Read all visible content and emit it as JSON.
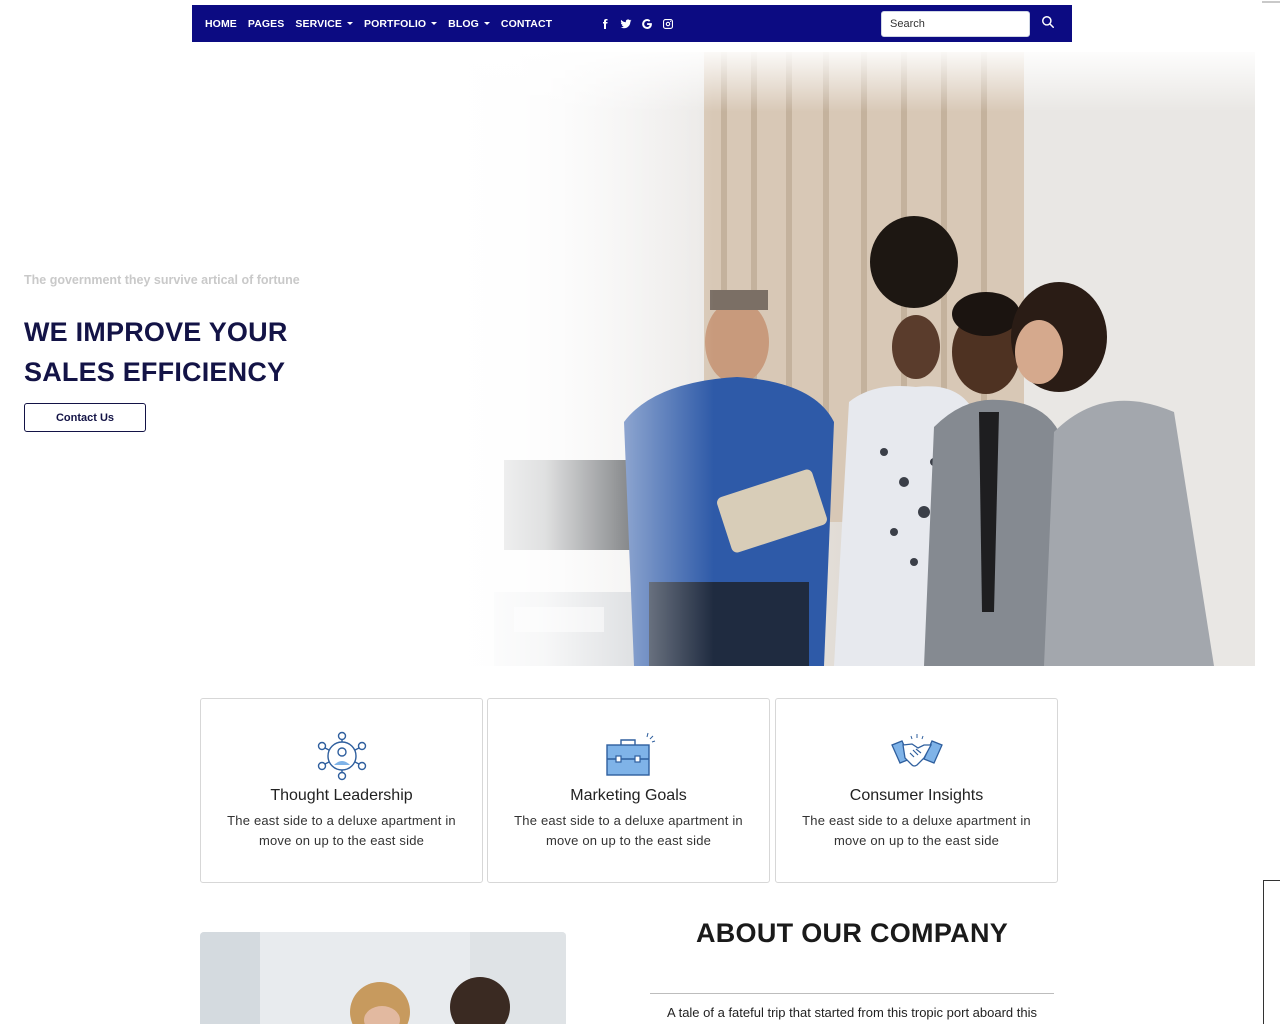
{
  "nav": {
    "items": [
      {
        "label": "HOME",
        "dropdown": false
      },
      {
        "label": "PAGES",
        "dropdown": false
      },
      {
        "label": "SERVICE",
        "dropdown": true
      },
      {
        "label": "PORTFOLIO",
        "dropdown": true
      },
      {
        "label": "BLOG",
        "dropdown": true
      },
      {
        "label": "CONTACT",
        "dropdown": false
      }
    ],
    "socials": [
      "facebook-icon",
      "twitter-icon",
      "google-icon",
      "instagram-icon"
    ],
    "search": {
      "placeholder": "Search",
      "value": ""
    },
    "bg_color": "#0c0b82"
  },
  "hero": {
    "subtitle": "The government they survive artical of fortune",
    "title_line1": "WE IMPROVE YOUR",
    "title_line2": "SALES EFFICIENCY",
    "button_label": "Contact Us",
    "title_color": "#131346"
  },
  "services": [
    {
      "icon": "network-people-icon",
      "title": "Thought Leadership",
      "text": "The east side to a deluxe apartment in move on up to the east side"
    },
    {
      "icon": "briefcase-icon",
      "title": "Marketing Goals",
      "text": "The east side to a deluxe apartment in move on up to the east side"
    },
    {
      "icon": "handshake-icon",
      "title": "Consumer Insights",
      "text": "The east side to a deluxe apartment in move on up to the east side"
    }
  ],
  "about": {
    "title": "ABOUT OUR COMPANY",
    "text": "A tale of a fateful trip that started from this tropic port aboard this"
  }
}
